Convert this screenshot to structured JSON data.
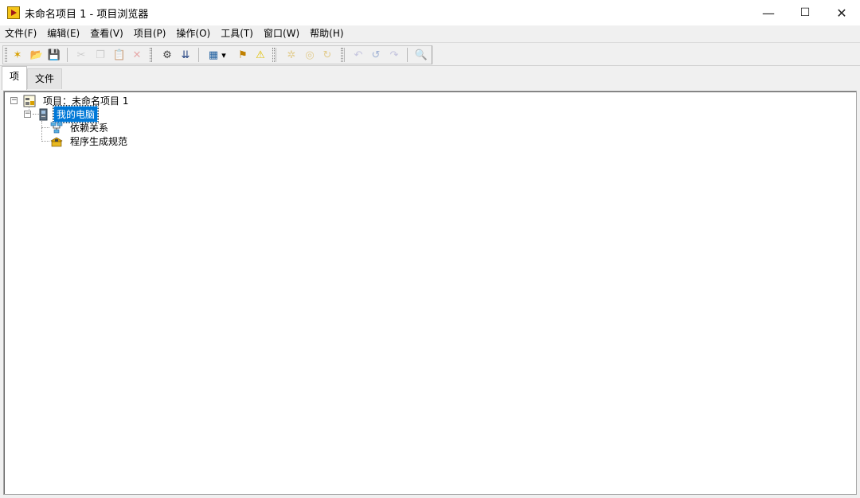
{
  "window": {
    "title": "未命名项目 1 - 项目浏览器",
    "controls": {
      "minimize": "—",
      "maximize": "☐",
      "close": "✕"
    }
  },
  "menu": [
    {
      "label": "文件(F)"
    },
    {
      "label": "编辑(E)"
    },
    {
      "label": "查看(V)"
    },
    {
      "label": "项目(P)"
    },
    {
      "label": "操作(O)"
    },
    {
      "label": "工具(T)"
    },
    {
      "label": "窗口(W)"
    },
    {
      "label": "帮助(H)"
    }
  ],
  "toolbar": {
    "buttons": [
      {
        "name": "new-icon",
        "glyph": "✶",
        "color": "#d8a000",
        "enabled": true
      },
      {
        "name": "open-icon",
        "glyph": "📂",
        "color": "#e0b000",
        "enabled": true
      },
      {
        "name": "save-all-icon",
        "glyph": "💾",
        "color": "#2040a0",
        "enabled": true
      },
      {
        "name": "cut-icon",
        "glyph": "✂",
        "color": "#b0b0b0",
        "enabled": false
      },
      {
        "name": "copy-icon",
        "glyph": "❐",
        "color": "#b0b0b0",
        "enabled": false
      },
      {
        "name": "paste-icon",
        "glyph": "📋",
        "color": "#b0b0b0",
        "enabled": false
      },
      {
        "name": "delete-icon",
        "glyph": "✕",
        "color": "#e07070",
        "enabled": false
      },
      {
        "name": "build-icon",
        "glyph": "⚙",
        "color": "#404040",
        "enabled": true
      },
      {
        "name": "deploy-icon",
        "glyph": "⇊",
        "color": "#204080",
        "enabled": true
      },
      {
        "name": "view-icon",
        "glyph": "▦",
        "color": "#2060a0",
        "enabled": true
      },
      {
        "name": "dropdown-arrow-icon",
        "glyph": "▾",
        "color": "#000000",
        "enabled": true
      },
      {
        "name": "properties-icon",
        "glyph": "⚑",
        "color": "#c08000",
        "enabled": true
      },
      {
        "name": "warning-icon",
        "glyph": "⚠",
        "color": "#e0c000",
        "enabled": true
      },
      {
        "name": "resolve-icon",
        "glyph": "✲",
        "color": "#d8b040",
        "enabled": false
      },
      {
        "name": "refresh-icon",
        "glyph": "◎",
        "color": "#d8b040",
        "enabled": false
      },
      {
        "name": "folder-sync-icon",
        "glyph": "↻",
        "color": "#d8b040",
        "enabled": false
      },
      {
        "name": "undo-icon",
        "glyph": "↶",
        "color": "#a0a0d0",
        "enabled": false
      },
      {
        "name": "undo-arrow-icon",
        "glyph": "↺",
        "color": "#6080c0",
        "enabled": false
      },
      {
        "name": "redo-icon",
        "glyph": "↷",
        "color": "#a0a0d0",
        "enabled": false
      },
      {
        "name": "find-icon",
        "glyph": "🔍",
        "color": "#a0a0d0",
        "enabled": false
      }
    ]
  },
  "tabs": [
    {
      "label": "项",
      "active": true
    },
    {
      "label": "文件",
      "active": false
    }
  ],
  "tree": {
    "root": {
      "label": "项目：未命名项目 1",
      "expander": "⊟",
      "icon": "project-icon"
    },
    "computer": {
      "label": "我的电脑",
      "expander": "⊟",
      "icon": "computer-icon",
      "selected": true
    },
    "children": [
      {
        "label": "依赖关系",
        "icon": "dependencies-icon"
      },
      {
        "label": "程序生成规范",
        "icon": "build-spec-icon"
      }
    ]
  }
}
